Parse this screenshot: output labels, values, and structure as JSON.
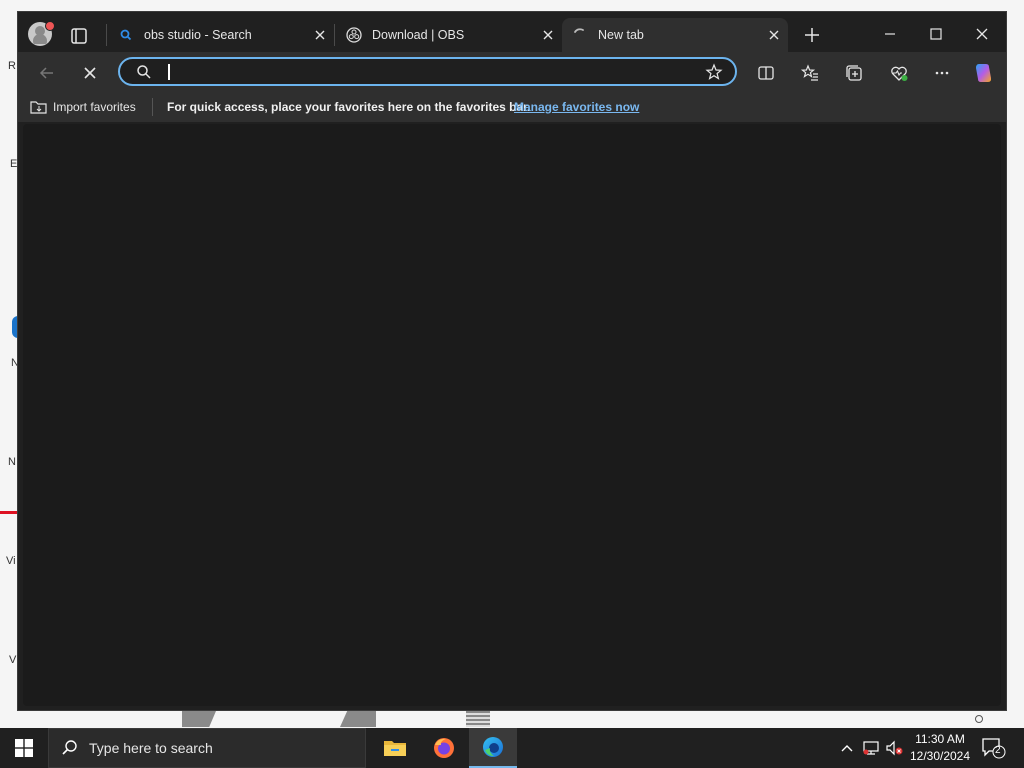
{
  "desktop": {
    "fragments": [
      "R",
      "E",
      "N",
      "N",
      "Vi",
      "V"
    ]
  },
  "tabs": [
    {
      "title": "obs studio - Search",
      "icon": "search-favicon",
      "active": false
    },
    {
      "title": "Download | OBS",
      "icon": "obs-favicon",
      "active": false
    },
    {
      "title": "New tab",
      "icon": "loading-spinner",
      "active": true
    }
  ],
  "address_bar": {
    "value": "",
    "placeholder": ""
  },
  "favorites_bar": {
    "import_label": "Import favorites",
    "message": "For quick access, place your favorites here on the favorites bar.",
    "manage_link": "Manage favorites now"
  },
  "taskbar": {
    "search_placeholder": "Type here to search",
    "time": "11:30 AM",
    "date": "12/30/2024",
    "notification_count": "2"
  },
  "colors": {
    "accent": "#6cb4ee",
    "link": "#7ab8f0",
    "window_bg": "#202020",
    "toolbar_bg": "#2f2f2f",
    "content_bg": "#1b1b1b"
  }
}
